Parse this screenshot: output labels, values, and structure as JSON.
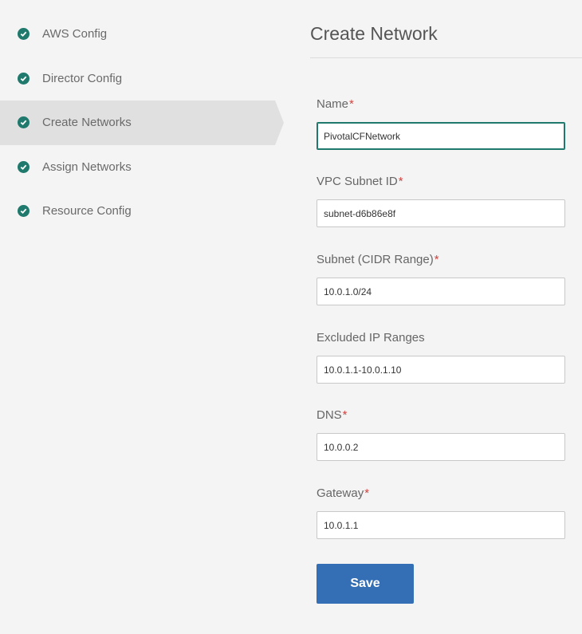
{
  "sidebar": {
    "items": [
      {
        "label": "AWS Config",
        "active": false
      },
      {
        "label": "Director Config",
        "active": false
      },
      {
        "label": "Create Networks",
        "active": true
      },
      {
        "label": "Assign Networks",
        "active": false
      },
      {
        "label": "Resource Config",
        "active": false
      }
    ]
  },
  "main": {
    "title": "Create Network",
    "fields": {
      "name": {
        "label": "Name",
        "required": "*",
        "value": "PivotalCFNetwork"
      },
      "vpc_subnet_id": {
        "label": "VPC Subnet ID",
        "required": "*",
        "value": "subnet-d6b86e8f"
      },
      "subnet_cidr": {
        "label": "Subnet (CIDR Range)",
        "required": "*",
        "value": "10.0.1.0/24"
      },
      "excluded_ip_ranges": {
        "label": "Excluded IP Ranges",
        "value": "10.0.1.1-10.0.1.10"
      },
      "dns": {
        "label": "DNS",
        "required": "*",
        "value": "10.0.0.2"
      },
      "gateway": {
        "label": "Gateway",
        "required": "*",
        "value": "10.0.1.1"
      }
    },
    "save_label": "Save"
  },
  "colors": {
    "accent": "#1f7a6d",
    "required": "#d0433f",
    "primary_button": "#346fb5",
    "sidebar_active": "#e0e0e0",
    "background": "#f4f4f4"
  }
}
